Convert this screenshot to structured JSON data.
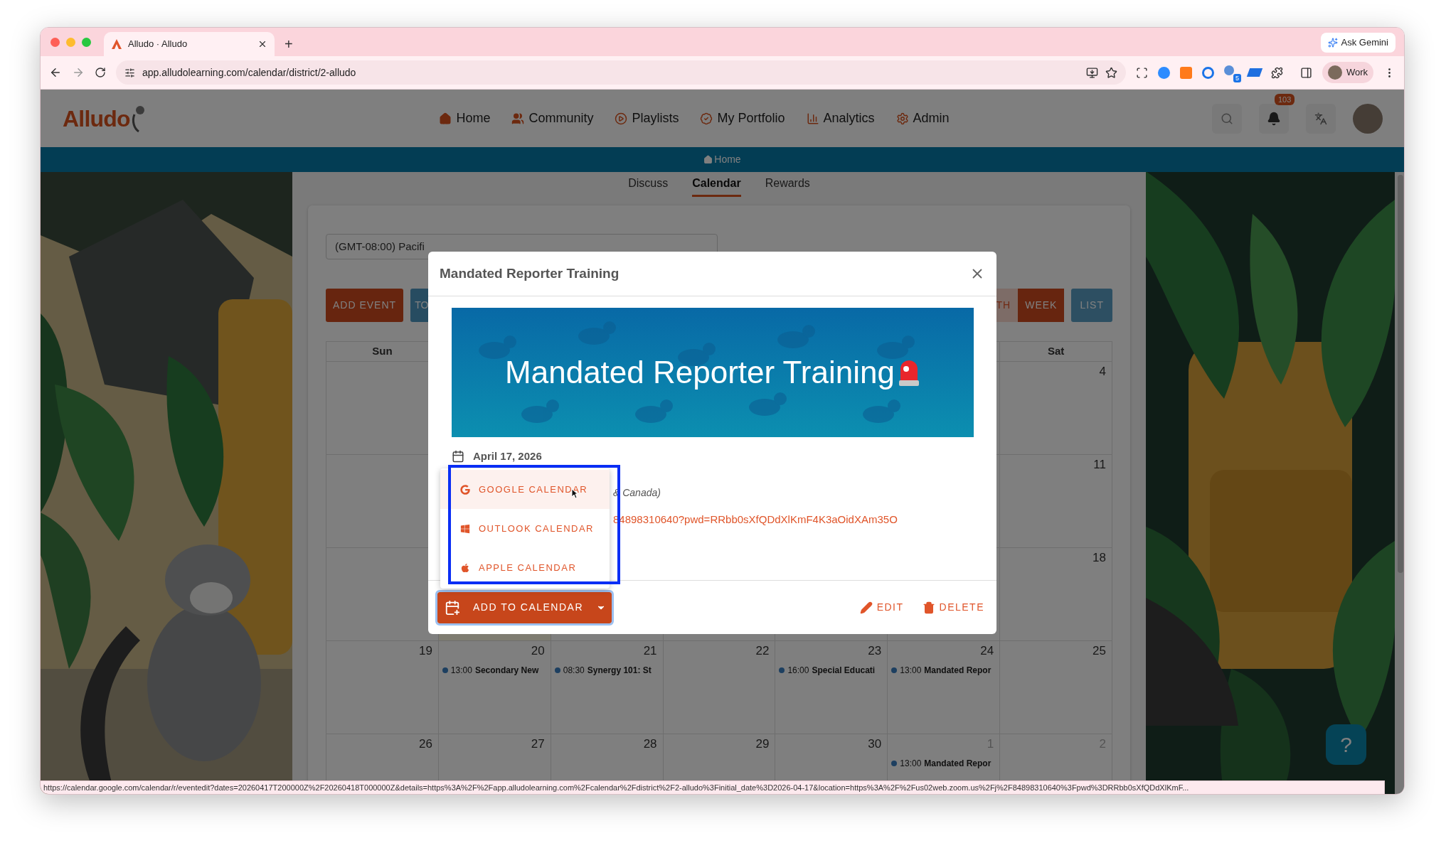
{
  "browser": {
    "tab_title": "Alludo · Alludo",
    "new_tab": "+",
    "gemini": "Ask Gemini",
    "url": "app.alludolearning.com/calendar/district/2-alludo",
    "extension_badge": "5",
    "profile": "Work"
  },
  "app": {
    "logo": "Alludo",
    "nav": [
      {
        "label": "Home"
      },
      {
        "label": "Community"
      },
      {
        "label": "Playlists"
      },
      {
        "label": "My Portfolio"
      },
      {
        "label": "Analytics"
      },
      {
        "label": "Admin"
      }
    ],
    "notifications": "103",
    "breadcrumb": "Home",
    "tabs": [
      {
        "label": "Discuss",
        "selected": false
      },
      {
        "label": "Calendar",
        "selected": true
      },
      {
        "label": "Rewards",
        "selected": false
      }
    ]
  },
  "calendar": {
    "timezone": "(GMT-08:00) Pacifi",
    "toolbar_left": [
      {
        "label": "ADD EVENT",
        "kind": "primary"
      },
      {
        "label": "TO",
        "kind": "secondary"
      }
    ],
    "views": [
      {
        "label": "TH",
        "selected": false
      },
      {
        "label": "WEEK",
        "selected": true
      }
    ],
    "list_button": "LIST",
    "weekdays": [
      "Sun",
      "Sat"
    ],
    "weeks": [
      {
        "cells": [
          {},
          {},
          {},
          {},
          {},
          {},
          {
            "date": "4"
          }
        ]
      },
      {
        "cells": [
          {},
          {},
          {},
          {},
          {},
          {},
          {
            "date": "11"
          }
        ]
      },
      {
        "cells": [
          {},
          {
            "today": true
          },
          {},
          {},
          {},
          {},
          {
            "date": "18"
          }
        ]
      },
      {
        "cells": [
          {
            "date": "19"
          },
          {
            "date": "20",
            "events": [
              {
                "time": "13:00",
                "title": "Secondary New"
              }
            ]
          },
          {
            "date": "21",
            "events": [
              {
                "time": "08:30",
                "title": "Synergy 101: St"
              }
            ]
          },
          {
            "date": "22"
          },
          {
            "date": "23",
            "events": [
              {
                "time": "16:00",
                "title": "Special Educati"
              }
            ]
          },
          {
            "date": "24",
            "events": [
              {
                "time": "13:00",
                "title": "Mandated Repor"
              }
            ]
          },
          {
            "date": "25"
          }
        ]
      },
      {
        "cells": [
          {
            "date": "26"
          },
          {
            "date": "27"
          },
          {
            "date": "28"
          },
          {
            "date": "29"
          },
          {
            "date": "30"
          },
          {
            "date": "1",
            "muted": true,
            "events": [
              {
                "time": "13:00",
                "title": "Mandated Repor"
              }
            ]
          },
          {
            "date": "2",
            "muted": true
          }
        ]
      }
    ]
  },
  "modal": {
    "title": "Mandated Reporter Training",
    "banner_title": "Mandated Reporter Training",
    "date": "April 17, 2026",
    "timezone": "& Canada)",
    "link": "84898310640?pwd=RRbb0sXfQDdXlKmF4K3aOidXAm35O",
    "menu": [
      {
        "label": "GOOGLE CALENDAR",
        "selected": true
      },
      {
        "label": "OUTLOOK CALENDAR",
        "selected": false
      },
      {
        "label": "APPLE CALENDAR",
        "selected": false
      }
    ],
    "add_button": "ADD TO CALENDAR",
    "actions": [
      {
        "label": "EDIT"
      },
      {
        "label": "DELETE"
      }
    ]
  },
  "help": "?",
  "status_url": "https://calendar.google.com/calendar/r/eventedit?dates=20260417T200000Z%2F20260418T000000Z&details=https%3A%2F%2Fapp.alludolearning.com%2Fcalendar%2Fdistrict%2F2-alludo%3Finitial_date%3D2026-04-17&location=https%3A%2F%2Fus02web.zoom.us%2Fj%2F84898310640%3Fpwd%3DRRbb0sXfQDdXlKmF..."
}
